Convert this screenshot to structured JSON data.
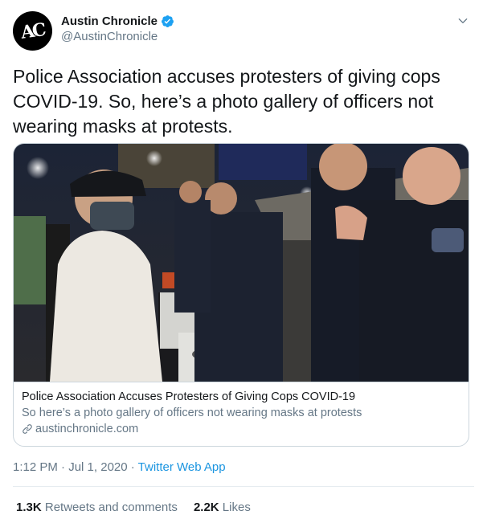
{
  "author": {
    "avatar_text": "AC",
    "display_name": "Austin Chronicle",
    "handle": "@AustinChronicle",
    "verified": true
  },
  "tweet": {
    "text": "Police Association accuses protesters of giving cops COVID-19. So, here’s a photo gallery of officers not wearing masks at protests."
  },
  "card": {
    "image_icon": "news-photo-protest-police",
    "title": "Police Association Accuses Protesters of Giving Cops COVID-19",
    "description": "So here’s a photo gallery of officers not wearing masks at protests",
    "domain": "austinchronicle.com"
  },
  "meta": {
    "time": "1:12 PM",
    "separator": " · ",
    "date": "Jul 1, 2020",
    "source_app": "Twitter Web App"
  },
  "stats": {
    "retweets_count": "1.3K",
    "retweets_label": "Retweets and comments",
    "likes_count": "2.2K",
    "likes_label": "Likes"
  },
  "colors": {
    "link_blue": "#1b95e0",
    "verified_blue": "#1da1f2",
    "secondary_text": "#657786",
    "border": "#ccd6dd"
  }
}
